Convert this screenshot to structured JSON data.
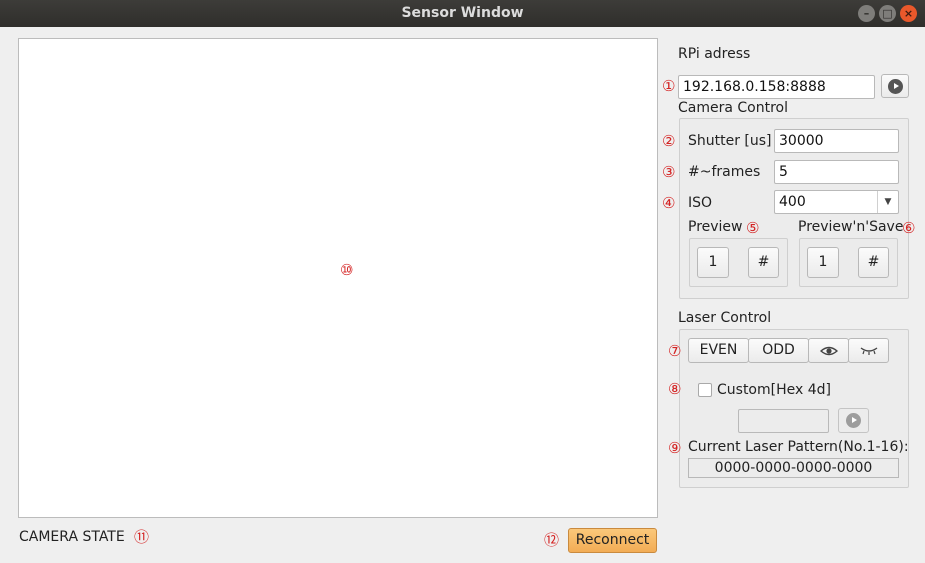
{
  "window": {
    "title": "Sensor Window",
    "controls": [
      "–",
      "□",
      "×"
    ]
  },
  "callouts": {
    "n1": "①",
    "n2": "②",
    "n3": "③",
    "n4": "④",
    "n5": "⑤",
    "n6": "⑥",
    "n7": "⑦",
    "n8": "⑧",
    "n9": "⑨",
    "n10": "⑩",
    "n11": "⑪",
    "n12": "⑫"
  },
  "rpi": {
    "label": "RPi adress",
    "value": "192.168.0.158:8888"
  },
  "camera": {
    "title": "Camera Control",
    "shutter_label": "Shutter [us]",
    "shutter_value": "30000",
    "frames_label": "#~frames",
    "frames_value": "5",
    "iso_label": "ISO",
    "iso_value": "400",
    "preview": {
      "label": "Preview",
      "btn_one": "1",
      "btn_multi": "#"
    },
    "preview_save": {
      "label": "Preview'n'Save",
      "btn_one": "1",
      "btn_multi": "#"
    }
  },
  "laser": {
    "title": "Laser Control",
    "even": "EVEN",
    "odd": "ODD",
    "custom_label": "Custom[Hex 4d]",
    "custom_value": "",
    "pattern_label": "Current Laser Pattern(No.1-16):",
    "pattern_value": "0000-0000-0000-0000"
  },
  "status": {
    "camera_state": "CAMERA STATE",
    "reconnect": "Reconnect"
  }
}
